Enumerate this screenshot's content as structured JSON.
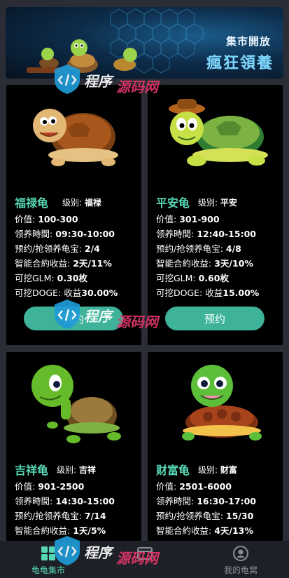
{
  "banner": {
    "line1": "集市開放",
    "line2": "瘋狂領養"
  },
  "labels": {
    "level": "级别:",
    "price": "价值:",
    "time": "领养時間:",
    "reserve": "预约/抢领养龟宝:",
    "income": "智能合約收益:",
    "glm": "可挖GLM:",
    "doge": "可挖DOGE:"
  },
  "cards": [
    {
      "name": "福禄龟",
      "level": "福禄",
      "price": "100-300",
      "time": "09:30-10:00",
      "reserve": "2/4",
      "income": "2天/11%",
      "glm": "0.30枚",
      "doge_prefix": "收益",
      "doge": "30.00%",
      "button": "预约"
    },
    {
      "name": "平安龟",
      "level": "平安",
      "price": "301-900",
      "time": "12:40-15:00",
      "reserve": "4/8",
      "income": "3天/10%",
      "glm": "0.60枚",
      "doge_prefix": "收益",
      "doge": "15.00%",
      "button": "预约"
    },
    {
      "name": "吉祥龟",
      "level": "吉祥",
      "price": "901-2500",
      "time": "14:30-15:00",
      "reserve": "7/14",
      "income": "1天/5%"
    },
    {
      "name": "财富龟",
      "level": "财富",
      "price": "2501-6000",
      "time": "16:30-17:00",
      "reserve": "15/30",
      "income": "4天/13%"
    }
  ],
  "tabs": [
    {
      "label": "龟龟集市",
      "icon": "grid-icon",
      "active": true
    },
    {
      "label": "",
      "icon": "wallet-icon",
      "active": false
    },
    {
      "label": "我的龟窝",
      "icon": "user-icon",
      "active": false
    }
  ],
  "watermark": {
    "text_a": "程序",
    "text_b": "源码网"
  },
  "colors": {
    "accent": "#56d6b4",
    "button": "#3eb39a",
    "background": "#2a2d35",
    "card": "#000000",
    "tabbar": "#1d2026"
  }
}
